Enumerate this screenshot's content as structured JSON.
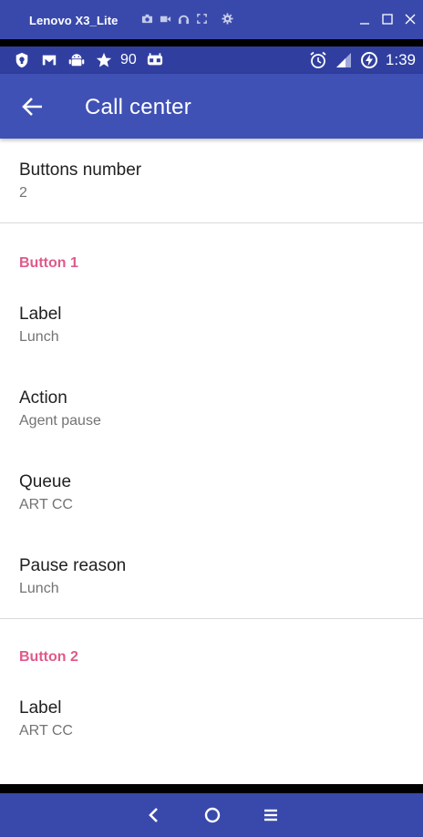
{
  "window": {
    "title": "Lenovo X3_Lite"
  },
  "status_bar": {
    "notification_count": "90",
    "time": "1:39"
  },
  "app_bar": {
    "title": "Call center"
  },
  "settings": {
    "buttons_number": {
      "title": "Buttons number",
      "summary": "2"
    },
    "button1": {
      "header": "Button 1",
      "label": {
        "title": "Label",
        "summary": "Lunch"
      },
      "action": {
        "title": "Action",
        "summary": "Agent pause"
      },
      "queue": {
        "title": "Queue",
        "summary": "ART CC"
      },
      "pause_reason": {
        "title": "Pause reason",
        "summary": "Lunch"
      }
    },
    "button2": {
      "header": "Button 2",
      "label": {
        "title": "Label",
        "summary": "ART CC"
      }
    }
  },
  "colors": {
    "app_bar": "#3f51b5",
    "status_bar": "#303f9f",
    "category_accent": "#e05a8a"
  },
  "icons": {
    "window_tools": [
      "camera-icon",
      "video-icon",
      "headphones-icon",
      "fullscreen-icon",
      "settings-icon"
    ],
    "window_controls": [
      "minimize-icon",
      "maximize-icon",
      "close-icon"
    ],
    "status_left": [
      "shield-icon",
      "gmail-icon",
      "android-icon",
      "star-icon",
      "cyanogen-icon"
    ],
    "status_right": [
      "alarm-icon",
      "signal-icon",
      "battery-charging-icon"
    ],
    "navigation": [
      "back-icon",
      "home-icon",
      "menu-icon"
    ]
  }
}
